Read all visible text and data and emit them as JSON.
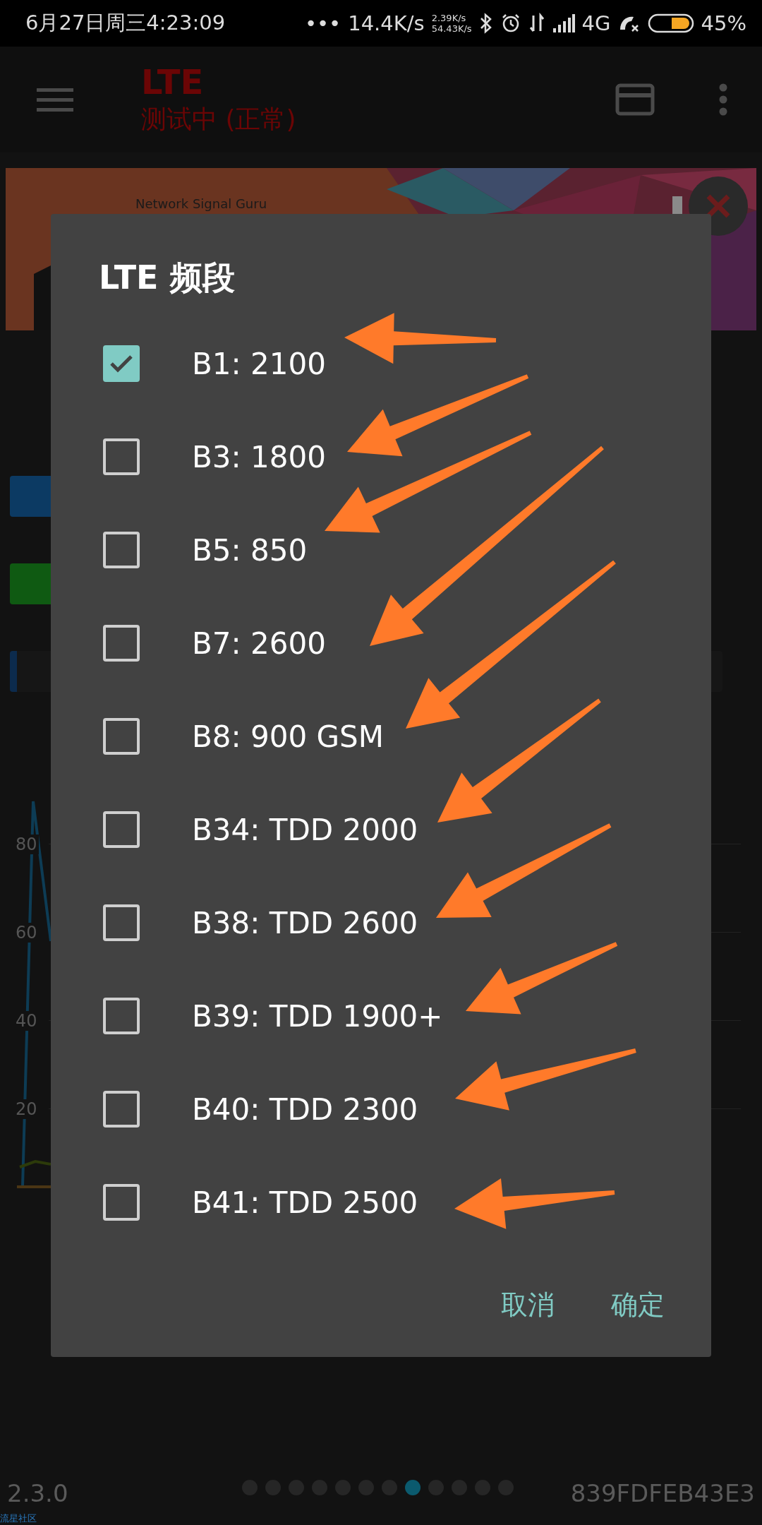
{
  "status_bar": {
    "datetime": "6月27日周三4:23:09",
    "more": "•••",
    "speed": "14.4K/s",
    "upload": "2.39K/s",
    "download": "54.43K/s",
    "network": "4G",
    "battery": "45%"
  },
  "toolbar": {
    "title": "LTE",
    "subtitle": "测试中 (正常)"
  },
  "ad": {
    "text": "Network Signal Guru"
  },
  "chart": {
    "y_labels": [
      "80",
      "60",
      "40",
      "20"
    ]
  },
  "dialog": {
    "title": "LTE 频段",
    "options": [
      {
        "label": "B1: 2100",
        "checked": true
      },
      {
        "label": "B3: 1800",
        "checked": false
      },
      {
        "label": "B5: 850",
        "checked": false
      },
      {
        "label": "B7: 2600",
        "checked": false
      },
      {
        "label": "B8: 900 GSM",
        "checked": false
      },
      {
        "label": "B34: TDD 2000",
        "checked": false
      },
      {
        "label": "B38: TDD 2600",
        "checked": false
      },
      {
        "label": "B39: TDD 1900+",
        "checked": false
      },
      {
        "label": "B40: TDD 2300",
        "checked": false
      },
      {
        "label": "B41: TDD 2500",
        "checked": false
      }
    ],
    "buttons": [
      "取消",
      "确定"
    ]
  },
  "footer": {
    "version": "2.3.0",
    "pages": [
      {
        "selected": false
      },
      {
        "selected": false
      },
      {
        "selected": false
      },
      {
        "selected": false
      },
      {
        "selected": false
      },
      {
        "selected": false
      },
      {
        "selected": false
      },
      {
        "selected": true
      },
      {
        "selected": false
      },
      {
        "selected": false
      },
      {
        "selected": false
      },
      {
        "selected": false
      }
    ],
    "device_id": "839FDFEB43E3",
    "watermark_link": "流星社区"
  }
}
